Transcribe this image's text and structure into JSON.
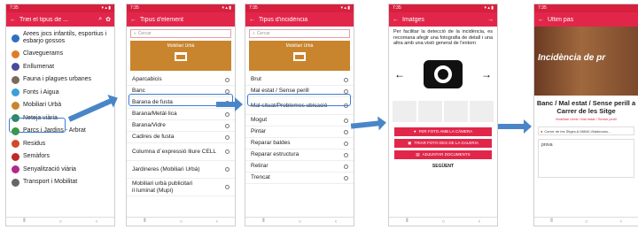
{
  "status_time": "7:35",
  "screen1": {
    "title": "Triei el tipus de ...",
    "items": [
      {
        "label": "Arees jocs infantils, esportius i esbarjo gossos",
        "color": "#2f6fc2"
      },
      {
        "label": "Claveguerams",
        "color": "#e07a2a"
      },
      {
        "label": "Enllumenat",
        "color": "#4a4a9a"
      },
      {
        "label": "Fauna i plagues urbanes",
        "color": "#7a6a5a"
      },
      {
        "label": "Fonts i Aigua",
        "color": "#3aa0d8"
      },
      {
        "label": "Mobiliari Urbà",
        "color": "#c9852e"
      },
      {
        "label": "Neteja viària",
        "color": "#2a8a5a"
      },
      {
        "label": "Parcs i Jardins - Arbrat",
        "color": "#3a9a3a"
      },
      {
        "label": "Residus",
        "color": "#d24a2a"
      },
      {
        "label": "Semàfors",
        "color": "#c02a2a"
      },
      {
        "label": "Senyalització viària",
        "color": "#b02a8a"
      },
      {
        "label": "Transport i Mobilitat",
        "color": "#666666"
      }
    ]
  },
  "screen2": {
    "title": "Tipus d'element",
    "search": "Cercar",
    "banner": "Mobiliari Urbà",
    "items": [
      "Aparcabicis",
      "Banc",
      "Barana de fusta",
      "Barana/Metàl·lica",
      "Barana/Vidre",
      "Cadires de fusta",
      "Columna d´expressió lliure CELL",
      "Jardineres (Mobiliari Urbà)",
      "Mobiliari urbà publicitari il·luminat (Mupi)"
    ]
  },
  "screen3": {
    "title": "Tipus d'incidència",
    "search": "Cercar",
    "banner": "Mobiliari Urbà",
    "items": [
      "Brut",
      "Mal estat / Sense perill",
      "Mal situat/Problemes ubicació",
      "Mogut",
      "Pintar",
      "Reparar baldes",
      "Reparar estructura",
      "Retirar",
      "Trencat"
    ]
  },
  "screen4": {
    "title": "Imatges",
    "desc": "Per facilitar la detecció de la incidència, es recomana afegir una fotografia de detall i una altra amb una visió general de l'entorn",
    "btn_camera": "FER FOTO AMB LA CÀMERA",
    "btn_gallery": "TRIAR FOTO DES DE LA GALERIA",
    "btn_docs": "ADJUNTAR DOCUMENTS",
    "btn_next": "SEGÜENT"
  },
  "screen5": {
    "title": "Últim pas",
    "overlay": "Incidència de pr",
    "headline": "Banc / Mal estat / Sense perill a Carrer de les Sitge",
    "sub": "Mobiliari Urbà / Mal estat / Sense perill",
    "address": "Carrer de les Sitges,6,08840,Viladecans...",
    "comment": "prova"
  },
  "colors": {
    "brand": "#e2264a",
    "arrow": "#4a86c7"
  }
}
